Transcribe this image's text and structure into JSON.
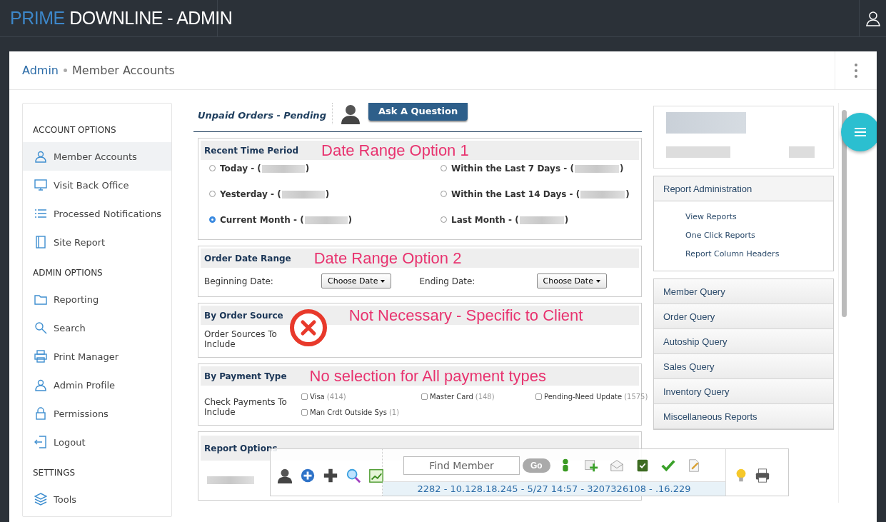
{
  "header": {
    "brand_accent": "PRIME",
    "brand": "DOWNLINE - ADMIN"
  },
  "breadcrumb": [
    {
      "label": "Admin",
      "kind": "link"
    },
    {
      "label": "Member Accounts",
      "kind": "current"
    }
  ],
  "sidebar": [
    {
      "title": "ACCOUNT OPTIONS",
      "items": [
        {
          "label": "Member Accounts",
          "selected": true
        },
        {
          "label": "Visit Back Office",
          "selected": false
        },
        {
          "label": "Processed Notifications",
          "selected": false
        },
        {
          "label": "Site Report",
          "selected": false
        }
      ]
    },
    {
      "title": "ADMIN OPTIONS",
      "items": [
        {
          "label": "Reporting",
          "selected": false
        },
        {
          "label": "Search",
          "selected": false
        },
        {
          "label": "Print Manager",
          "selected": false
        },
        {
          "label": "Admin Profile",
          "selected": false
        },
        {
          "label": "Permissions",
          "selected": false
        },
        {
          "label": "Logout",
          "selected": false
        }
      ]
    },
    {
      "title": "SETTINGS",
      "items": [
        {
          "label": "Tools",
          "selected": false
        }
      ]
    }
  ],
  "report": {
    "title": "Unpaid Orders - Pending",
    "ask_button": "Ask A Question"
  },
  "panels": [
    {
      "kind": "radios",
      "title": "Recent Time Period",
      "annotation": "Date Range Option 1",
      "options": [
        {
          "prefix": "Today - (",
          "suffix": ")",
          "selected": false
        },
        {
          "prefix": "Within the Last 7 Days - (",
          "suffix": ")",
          "selected": false
        },
        {
          "prefix": "Yesterday - (",
          "suffix": ")",
          "selected": false
        },
        {
          "prefix": "Within the Last 14 Days - (",
          "suffix": ")",
          "selected": false
        },
        {
          "prefix": "Current Month - (",
          "suffix": ")",
          "selected": true
        },
        {
          "prefix": "Last Month - (",
          "suffix": ")",
          "selected": false
        }
      ]
    },
    {
      "kind": "dates",
      "title": "Order Date Range",
      "annotation": "Date Range Option 2",
      "fields": [
        {
          "label": "Beginning Date:",
          "button": "Choose Date"
        },
        {
          "label": "Ending Date:",
          "button": "Choose Date"
        }
      ]
    },
    {
      "kind": "source",
      "title": "By Order Source",
      "annotation": "Not Necessary - Specific to Client",
      "label": "Order Sources To Include"
    },
    {
      "kind": "payments",
      "title": "By Payment Type",
      "annotation": "No selection for All payment types",
      "label": "Check Payments To Include",
      "options": [
        {
          "name": "Visa",
          "count": "(414)",
          "checked": false
        },
        {
          "name": "Master Card",
          "count": "(148)",
          "checked": false
        },
        {
          "name": "Pending-Need Update",
          "count": "(1575)",
          "checked": false
        },
        {
          "name": "Man Crdt Outside Sys",
          "count": "(1)",
          "checked": false
        }
      ]
    },
    {
      "kind": "options",
      "title": "Report Options"
    }
  ],
  "right_panel": {
    "admin": {
      "title": "Report Administration",
      "links": [
        "View Reports",
        "One Click Reports",
        "Report Column Headers"
      ]
    },
    "queries": [
      "Member Query",
      "Order Query",
      "Autoship Query",
      "Sales Query",
      "Inventory Query",
      "Miscellaneous Reports"
    ]
  },
  "toolbar": {
    "search": {
      "placeholder": "Find Member",
      "button": "Go"
    },
    "status": "2282 - 10.128.18.245 - 5/27 14:57 - 3207326108 - .16.229"
  }
}
